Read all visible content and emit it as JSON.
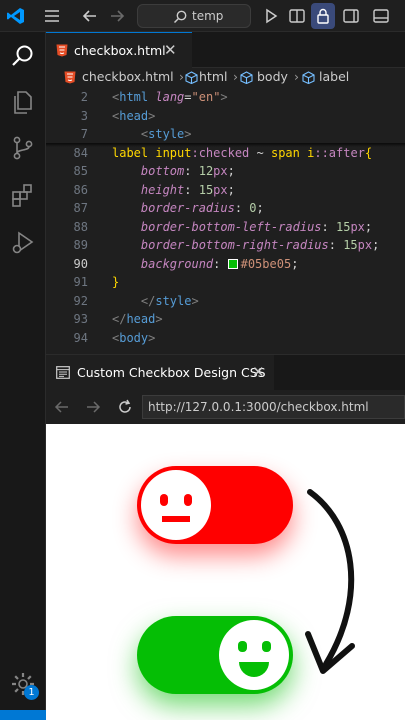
{
  "titlebar": {
    "search_label": "temp"
  },
  "editor_tab": {
    "label": "checkbox.html",
    "close": "✕"
  },
  "breadcrumb": {
    "file": "checkbox.html",
    "el1": "html",
    "el2": "body",
    "el3": "label"
  },
  "code": [
    {
      "ln": "2",
      "tokens": [
        [
          "<",
          "punc"
        ],
        [
          "html",
          "name"
        ],
        [
          " ",
          "white"
        ],
        [
          "lang",
          "attr"
        ],
        [
          "=",
          "white"
        ],
        [
          "\"en\"",
          "str"
        ],
        [
          ">",
          "punc"
        ]
      ]
    },
    {
      "ln": "3",
      "tokens": [
        [
          "<",
          "punc"
        ],
        [
          "head",
          "name"
        ],
        [
          ">",
          "punc"
        ]
      ]
    },
    {
      "ln": "7",
      "tokens": [
        [
          "    ",
          "white"
        ],
        [
          "<",
          "punc"
        ],
        [
          "style",
          "name"
        ],
        [
          ">",
          "punc"
        ]
      ]
    },
    {
      "ln": "84",
      "tokens": [
        [
          "label",
          "tag"
        ],
        [
          " ",
          "white"
        ],
        [
          "input",
          "tag"
        ],
        [
          ":checked",
          "sel"
        ],
        [
          " ~ ",
          "white"
        ],
        [
          "span",
          "tag"
        ],
        [
          " ",
          "white"
        ],
        [
          "i",
          "tag"
        ],
        [
          "::after",
          "sel"
        ],
        [
          "{",
          "brace"
        ]
      ]
    },
    {
      "ln": "85",
      "tokens": [
        [
          "    ",
          "white"
        ],
        [
          "bottom",
          "prop"
        ],
        [
          ": ",
          "white"
        ],
        [
          "12",
          "num"
        ],
        [
          "px",
          "unit"
        ],
        [
          ";",
          "white"
        ]
      ]
    },
    {
      "ln": "86",
      "tokens": [
        [
          "    ",
          "white"
        ],
        [
          "height",
          "prop"
        ],
        [
          ": ",
          "white"
        ],
        [
          "15",
          "num"
        ],
        [
          "px",
          "unit"
        ],
        [
          ";",
          "white"
        ]
      ]
    },
    {
      "ln": "87",
      "tokens": [
        [
          "    ",
          "white"
        ],
        [
          "border-radius",
          "prop"
        ],
        [
          ": ",
          "white"
        ],
        [
          "0",
          "num"
        ],
        [
          ";",
          "white"
        ]
      ]
    },
    {
      "ln": "88",
      "tokens": [
        [
          "    ",
          "white"
        ],
        [
          "border-bottom-left-radius",
          "prop"
        ],
        [
          ": ",
          "white"
        ],
        [
          "15",
          "num"
        ],
        [
          "px",
          "unit"
        ],
        [
          ";",
          "white"
        ]
      ]
    },
    {
      "ln": "89",
      "tokens": [
        [
          "    ",
          "white"
        ],
        [
          "border-bottom-right-radius",
          "prop"
        ],
        [
          ": ",
          "white"
        ],
        [
          "15",
          "num"
        ],
        [
          "px",
          "unit"
        ],
        [
          ";",
          "white"
        ]
      ]
    },
    {
      "ln": "90",
      "tokens": [
        [
          "    ",
          "white"
        ],
        [
          "background",
          "prop"
        ],
        [
          ": ",
          "white"
        ],
        [
          "#SWATCH#",
          "swatch"
        ],
        [
          "#05be05",
          "str"
        ],
        [
          ";",
          "white"
        ]
      ]
    },
    {
      "ln": "91",
      "tokens": [
        [
          "}",
          "brace"
        ]
      ]
    },
    {
      "ln": "92",
      "tokens": [
        [
          "    ",
          "white"
        ],
        [
          "</",
          "punc"
        ],
        [
          "style",
          "name"
        ],
        [
          ">",
          "punc"
        ]
      ]
    },
    {
      "ln": "93",
      "tokens": [
        [
          "</",
          "punc"
        ],
        [
          "head",
          "name"
        ],
        [
          ">",
          "punc"
        ]
      ]
    },
    {
      "ln": "94",
      "tokens": [
        [
          "<",
          "punc"
        ],
        [
          "body",
          "name"
        ],
        [
          ">",
          "punc"
        ]
      ]
    }
  ],
  "preview_tab": {
    "label": "Custom Checkbox Design CSS",
    "close": "✕"
  },
  "address_bar": {
    "url": "http://127.0.0.1:3000/checkbox.html"
  },
  "notification_badge": "1",
  "colors": {
    "off": "#ff0000",
    "on": "#05be05",
    "swatch": "#05be05"
  }
}
